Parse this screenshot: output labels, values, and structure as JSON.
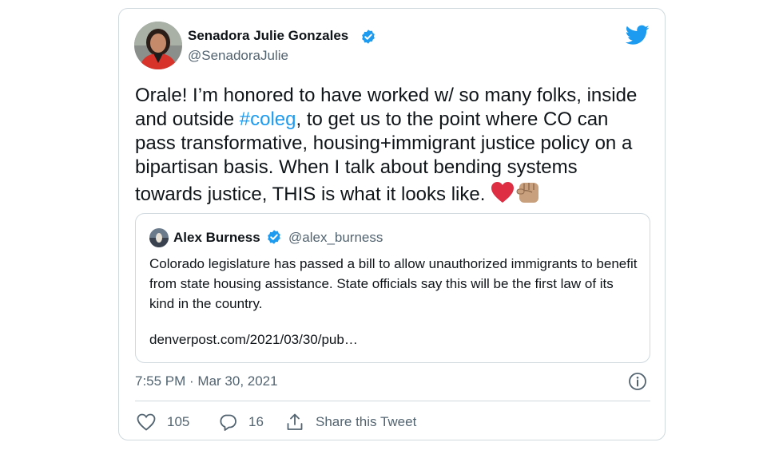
{
  "tweet": {
    "author_name": "Senadora Julie Gonzales",
    "author_handle": "@SenadoraJulie",
    "text_parts": [
      "Orale! I’m honored to have worked w/ so many folks, inside and outside ",
      "#coleg",
      ", to get us to the point where CO can pass transformative, housing+immigrant justice policy on a bipartisan basis. When I talk about bending systems towards justice, THIS is what it looks like. "
    ],
    "emojis": [
      "red-heart",
      "raised-fist-medium-skin-tone"
    ],
    "timestamp": "7:55 PM · Mar 30, 2021",
    "like_count": "105",
    "reply_count": "16",
    "share_label": "Share this Tweet"
  },
  "quoted": {
    "author_name": "Alex Burness",
    "author_handle": "@alex_burness",
    "text": "Colorado legislature has passed a bill to allow unauthorized immigrants to benefit from state housing assistance. State officials say this will be the first law of its kind in the country.",
    "link": "denverpost.com/2021/03/30/pub…"
  },
  "colors": {
    "link_blue": "#1d9bf0",
    "secondary_text": "#536471",
    "border": "#cfd9de",
    "heart_red": "#dd2e44"
  }
}
